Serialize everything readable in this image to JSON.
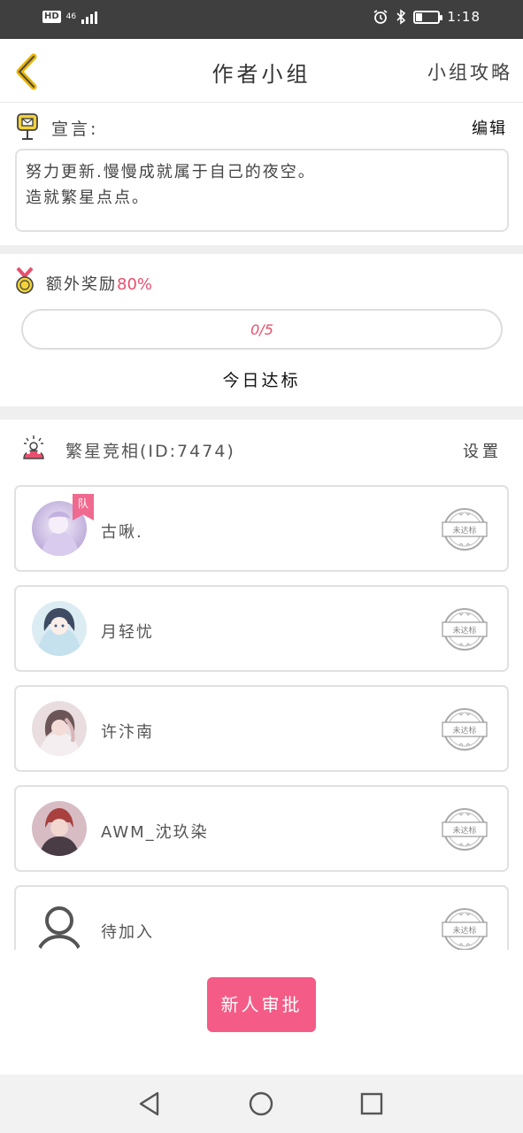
{
  "status_bar": {
    "hd": "HD",
    "network": "46",
    "time": "1:18",
    "icons": [
      "alarm-icon",
      "bluetooth-icon",
      "battery-icon"
    ]
  },
  "header": {
    "title": "作者小组",
    "guide_label": "小组攻略",
    "back_icon": "chevron-left-icon"
  },
  "manifesto": {
    "label": "宣言:",
    "edit_label": "编辑",
    "text_line1": "努力更新.慢慢成就属于自己的夜空。",
    "text_line2": "造就繁星点点。"
  },
  "reward": {
    "label": "额外奖励",
    "percent": "80%",
    "progress_text": "0/5",
    "progress_fraction": 0,
    "today_label": "今日达标"
  },
  "group": {
    "name": "繁星竞相(ID:7474)",
    "settings_label": "设置",
    "members": [
      {
        "name": "古啾.",
        "tag": "队",
        "status": "未达标"
      },
      {
        "name": "月轻忧",
        "tag": "",
        "status": "未达标"
      },
      {
        "name": "许汴南",
        "tag": "",
        "status": "未达标"
      },
      {
        "name": "AWM_沈玖染",
        "tag": "",
        "status": "未达标"
      },
      {
        "name": "待加入",
        "tag": "",
        "status": "未达标"
      }
    ]
  },
  "approve_button": "新人审批",
  "colors": {
    "accent": "#f45b86",
    "back_arrow": "#e8b400",
    "status_bar": "#3f3f3f"
  }
}
